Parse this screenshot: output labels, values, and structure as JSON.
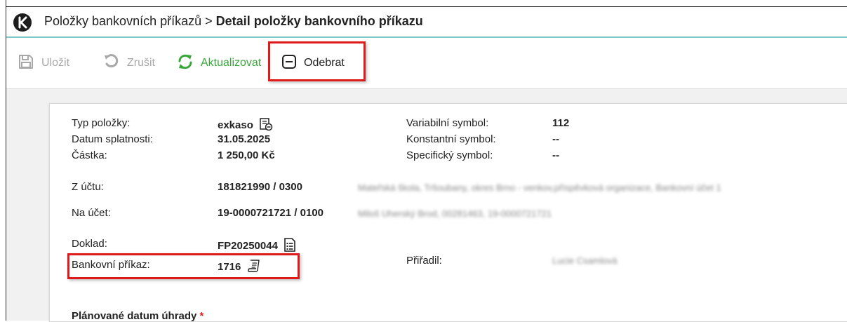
{
  "breadcrumb": {
    "parent": "Položky bankovních příkazů",
    "separator": ">",
    "current": "Detail položky bankovního příkazu"
  },
  "toolbar": {
    "save_label": "Uložit",
    "cancel_label": "Zrušit",
    "refresh_label": "Aktualizovat",
    "remove_label": "Odebrat"
  },
  "details": {
    "type_label": "Typ položky:",
    "type_value": "exkaso",
    "due_label": "Datum splatnosti:",
    "due_value": "31.05.2025",
    "amount_label": "Částka:",
    "amount_value": "1 250,00 Kč",
    "vs_label": "Variabilní symbol:",
    "vs_value": "112",
    "ks_label": "Konstantní symbol:",
    "ks_value": "--",
    "ss_label": "Specifický symbol:",
    "ss_value": "--",
    "from_label": "Z účtu:",
    "from_value": "181821990 / 0300",
    "from_name": "Mateřská škola, Tršoubany, okres Brno - venkov,příspěvková organizace, Bankovní účet 1",
    "to_label": "Na účet:",
    "to_value": "19-0000721721 / 0100",
    "to_name": "Miloš Uherský Brod, 00281463, 19-0000721721",
    "doc_label": "Doklad:",
    "doc_value": "FP20250044",
    "order_label": "Bankovní příkaz:",
    "order_value": "1716",
    "assigned_label": "Přiřadil:",
    "assigned_value": "Lucie Csamlová",
    "planned_label": "Plánované datum úhrady",
    "required_mark": "*"
  },
  "colors": {
    "accent_line": "#7fc6c6",
    "highlight": "#e01a1a",
    "refresh": "#3aa63a",
    "disabled": "#a8a8a8"
  },
  "icons": {
    "logo": "app-logo-icon",
    "save": "floppy-disk-icon",
    "cancel": "undo-icon",
    "refresh": "refresh-icon",
    "remove": "minus-square-icon",
    "type": "document-minus-icon",
    "doc": "document-list-icon",
    "order": "receipt-icon"
  }
}
